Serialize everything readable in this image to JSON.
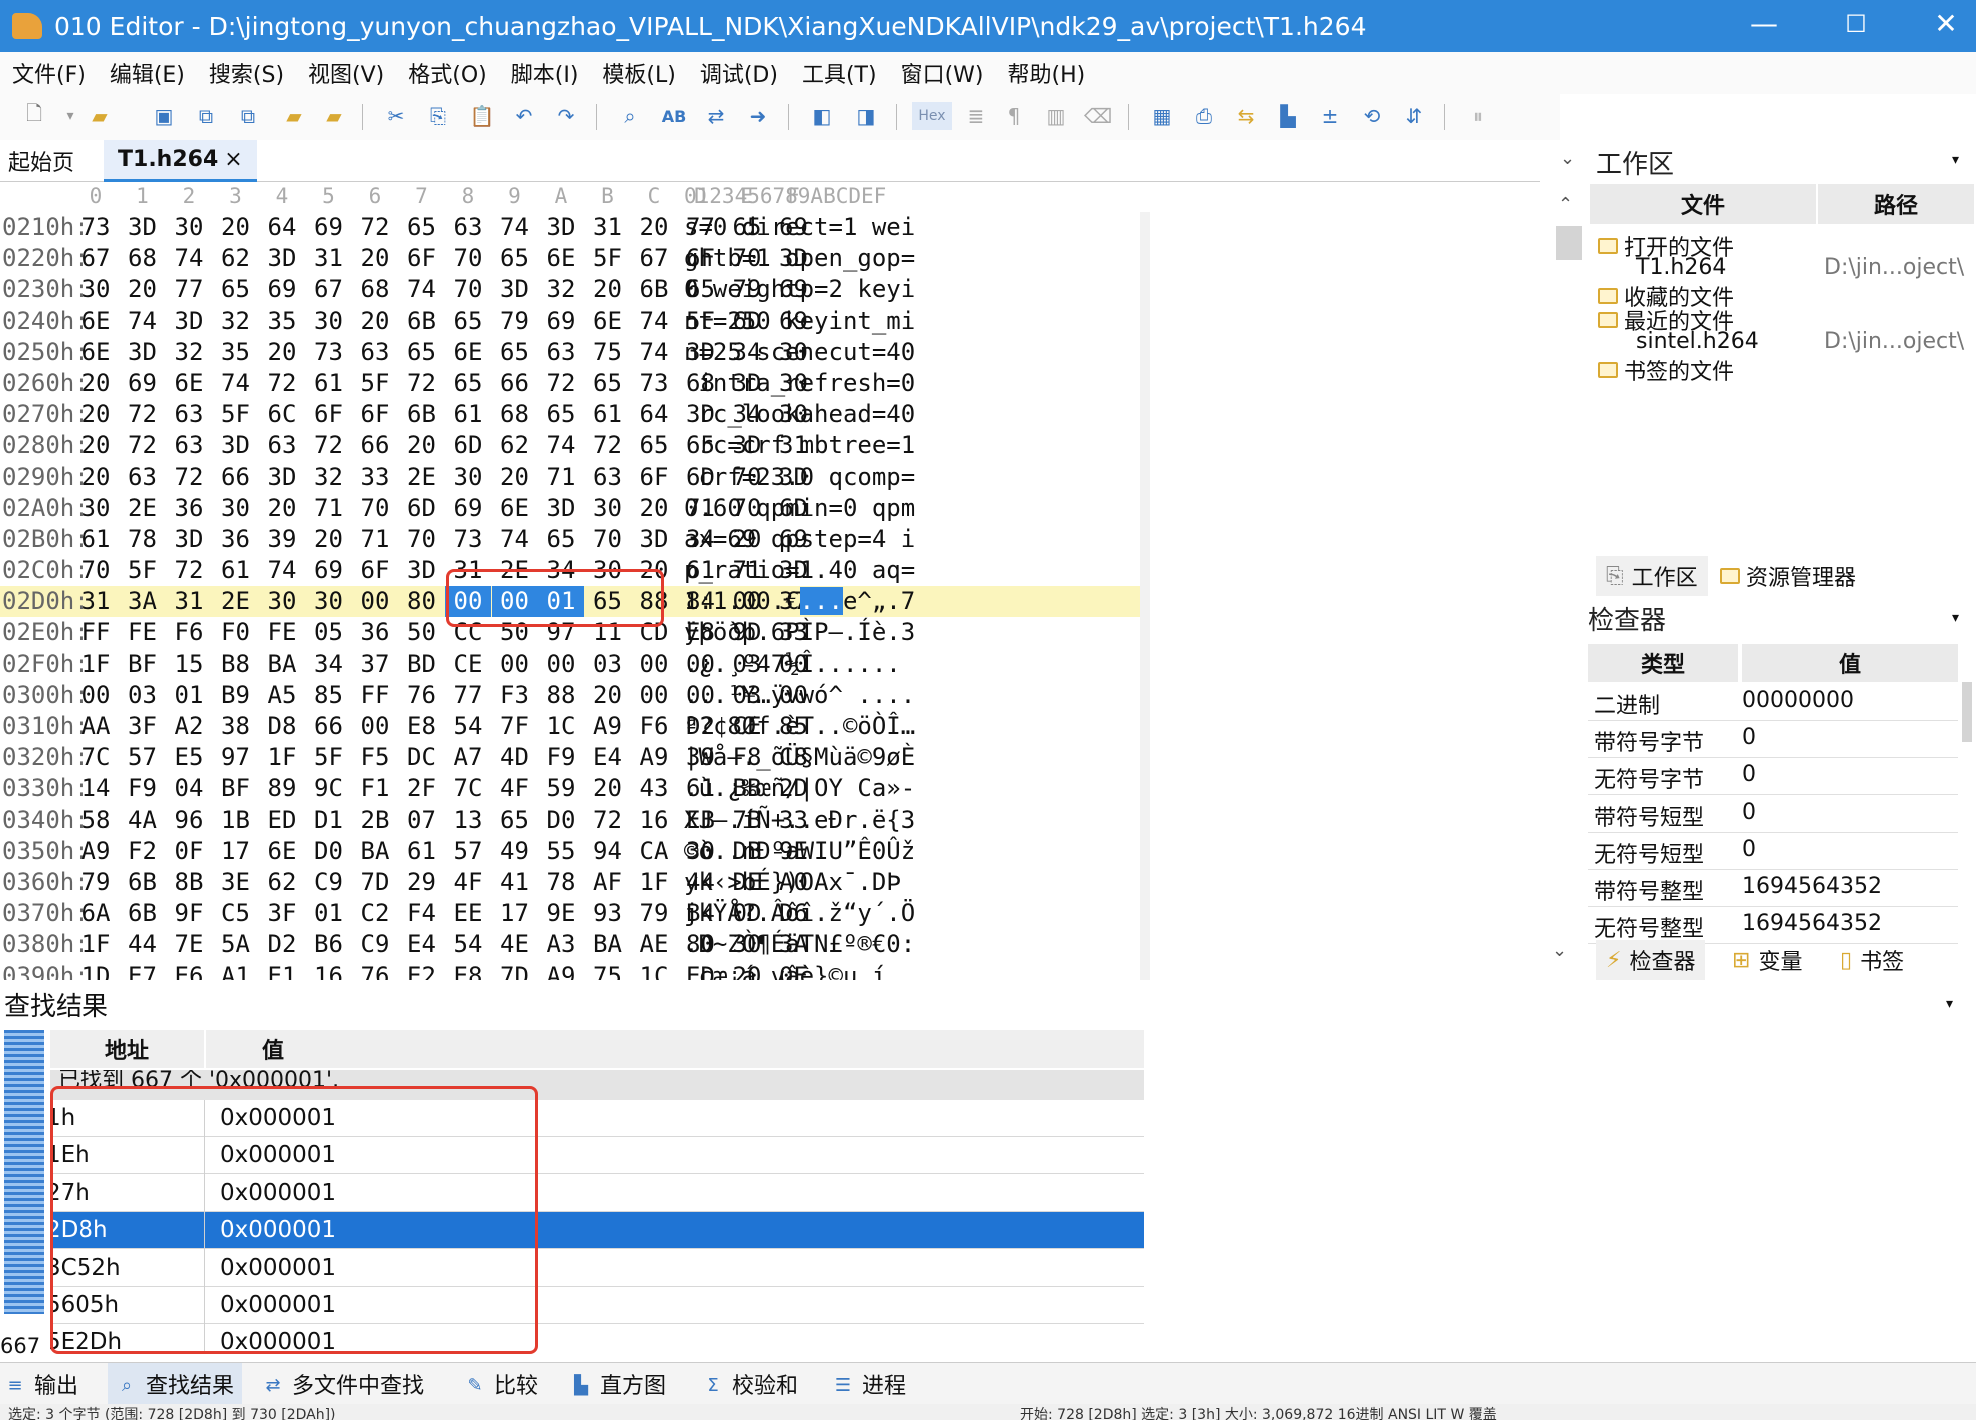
{
  "window": {
    "title": "010 Editor - D:\\jingtong_yunyon_chuangzhao_VIPALL_NDK\\XiangXueNDKAllVIP\\ndk29_av\\project\\T1.h264",
    "minimize": "—",
    "maximize": "☐",
    "close": "✕"
  },
  "menu": [
    "文件(F)",
    "编辑(E)",
    "搜索(S)",
    "视图(V)",
    "格式(O)",
    "脚本(I)",
    "模板(L)",
    "调试(D)",
    "工具(T)",
    "窗口(W)",
    "帮助(H)"
  ],
  "tabs": {
    "start": "起始页",
    "file": "T1.h264",
    "close": "×"
  },
  "toolbar": {
    "hex_label": "Hex"
  },
  "hex": {
    "col_headers": [
      "0",
      "1",
      "2",
      "3",
      "4",
      "5",
      "6",
      "7",
      "8",
      "9",
      "A",
      "B",
      "C",
      "D",
      "E",
      "F"
    ],
    "ascii_header": "0123456789ABCDEF",
    "rows": [
      {
        "addr": "0210h:",
        "bytes": [
          "73",
          "3D",
          "30",
          "20",
          "64",
          "69",
          "72",
          "65",
          "63",
          "74",
          "3D",
          "31",
          "20",
          "77",
          "65",
          "69"
        ],
        "ascii": "s=0 direct=1 wei"
      },
      {
        "addr": "0220h:",
        "bytes": [
          "67",
          "68",
          "74",
          "62",
          "3D",
          "31",
          "20",
          "6F",
          "70",
          "65",
          "6E",
          "5F",
          "67",
          "6F",
          "70",
          "3D"
        ],
        "ascii": "ghtb=1 open_gop="
      },
      {
        "addr": "0230h:",
        "bytes": [
          "30",
          "20",
          "77",
          "65",
          "69",
          "67",
          "68",
          "74",
          "70",
          "3D",
          "32",
          "20",
          "6B",
          "65",
          "79",
          "69"
        ],
        "ascii": "0 weightp=2 keyi"
      },
      {
        "addr": "0240h:",
        "bytes": [
          "6E",
          "74",
          "3D",
          "32",
          "35",
          "30",
          "20",
          "6B",
          "65",
          "79",
          "69",
          "6E",
          "74",
          "5F",
          "6D",
          "69"
        ],
        "ascii": "nt=250 keyint_mi"
      },
      {
        "addr": "0250h:",
        "bytes": [
          "6E",
          "3D",
          "32",
          "35",
          "20",
          "73",
          "63",
          "65",
          "6E",
          "65",
          "63",
          "75",
          "74",
          "3D",
          "34",
          "30"
        ],
        "ascii": "n=25 scenecut=40"
      },
      {
        "addr": "0260h:",
        "bytes": [
          "20",
          "69",
          "6E",
          "74",
          "72",
          "61",
          "5F",
          "72",
          "65",
          "66",
          "72",
          "65",
          "73",
          "68",
          "3D",
          "30"
        ],
        "ascii": " intra_refresh=0"
      },
      {
        "addr": "0270h:",
        "bytes": [
          "20",
          "72",
          "63",
          "5F",
          "6C",
          "6F",
          "6F",
          "6B",
          "61",
          "68",
          "65",
          "61",
          "64",
          "3D",
          "34",
          "30"
        ],
        "ascii": " rc_lookahead=40"
      },
      {
        "addr": "0280h:",
        "bytes": [
          "20",
          "72",
          "63",
          "3D",
          "63",
          "72",
          "66",
          "20",
          "6D",
          "62",
          "74",
          "72",
          "65",
          "65",
          "3D",
          "31"
        ],
        "ascii": " rc=crf mbtree=1"
      },
      {
        "addr": "0290h:",
        "bytes": [
          "20",
          "63",
          "72",
          "66",
          "3D",
          "32",
          "33",
          "2E",
          "30",
          "20",
          "71",
          "63",
          "6F",
          "6D",
          "70",
          "3D"
        ],
        "ascii": " crf=23.0 qcomp="
      },
      {
        "addr": "02A0h:",
        "bytes": [
          "30",
          "2E",
          "36",
          "30",
          "20",
          "71",
          "70",
          "6D",
          "69",
          "6E",
          "3D",
          "30",
          "20",
          "71",
          "70",
          "6D"
        ],
        "ascii": "0.60 qpmin=0 qpm"
      },
      {
        "addr": "02B0h:",
        "bytes": [
          "61",
          "78",
          "3D",
          "36",
          "39",
          "20",
          "71",
          "70",
          "73",
          "74",
          "65",
          "70",
          "3D",
          "34",
          "20",
          "69"
        ],
        "ascii": "ax=69 qpstep=4 i"
      },
      {
        "addr": "02C0h:",
        "bytes": [
          "70",
          "5F",
          "72",
          "61",
          "74",
          "69",
          "6F",
          "3D",
          "31",
          "2E",
          "34",
          "30",
          "20",
          "61",
          "71",
          "3D"
        ],
        "ascii": "p_ratio=1.40 aq="
      },
      {
        "addr": "02D0h:",
        "bytes": [
          "31",
          "3A",
          "31",
          "2E",
          "30",
          "30",
          "00",
          "80",
          "00",
          "00",
          "01",
          "65",
          "88",
          "84",
          "00",
          "37"
        ],
        "ascii_pre": "1:1.00.€",
        "ascii_sel": "...",
        "ascii_post": "e^„.7",
        "highlight": true
      },
      {
        "addr": "02E0h:",
        "bytes": [
          "FF",
          "FE",
          "F6",
          "F0",
          "FE",
          "05",
          "36",
          "50",
          "CC",
          "50",
          "97",
          "11",
          "CD",
          "E8",
          "9D",
          "33"
        ],
        "ascii": "ÿþöðþ.6PÌP—.Íè.3"
      },
      {
        "addr": "02F0h:",
        "bytes": [
          "1F",
          "BF",
          "15",
          "B8",
          "BA",
          "34",
          "37",
          "BD",
          "CE",
          "00",
          "00",
          "03",
          "00",
          "00",
          "03",
          "00"
        ],
        "ascii": ".¿.¸º47½Î......"
      },
      {
        "addr": "0300h:",
        "bytes": [
          "00",
          "03",
          "01",
          "B9",
          "A5",
          "85",
          "FF",
          "76",
          "77",
          "F3",
          "88",
          "20",
          "00",
          "00",
          "03",
          "00"
        ],
        "ascii": "...¹¥…ÿvwó^ ...."
      },
      {
        "addr": "0310h:",
        "bytes": [
          "AA",
          "3F",
          "A2",
          "38",
          "D8",
          "66",
          "00",
          "E8",
          "54",
          "7F",
          "1C",
          "A9",
          "F6",
          "D2",
          "CE",
          "85"
        ],
        "ascii": "ª?¢8Øf.èT..©öÒÎ…"
      },
      {
        "addr": "0320h:",
        "bytes": [
          "7C",
          "57",
          "E5",
          "97",
          "1F",
          "5F",
          "F5",
          "DC",
          "A7",
          "4D",
          "F9",
          "E4",
          "A9",
          "39",
          "F8",
          "C8"
        ],
        "ascii": "|Wå—._õÜ§Mùä©9øÈ"
      },
      {
        "addr": "0330h:",
        "bytes": [
          "14",
          "F9",
          "04",
          "BF",
          "89",
          "9C",
          "F1",
          "2F",
          "7C",
          "4F",
          "59",
          "20",
          "43",
          "61",
          "BB",
          "2D"
        ],
        "ascii": ".ù.¿‰œñ/|OY Ca»-"
      },
      {
        "addr": "0340h:",
        "bytes": [
          "58",
          "4A",
          "96",
          "1B",
          "ED",
          "D1",
          "2B",
          "07",
          "13",
          "65",
          "D0",
          "72",
          "16",
          "EB",
          "7B",
          "33"
        ],
        "ascii": "XJ–.íÑ+..eÐr.ë{3"
      },
      {
        "addr": "0350h:",
        "bytes": [
          "A9",
          "F2",
          "0F",
          "17",
          "6E",
          "D0",
          "BA",
          "61",
          "57",
          "49",
          "55",
          "94",
          "CA",
          "30",
          "DB",
          "9E"
        ],
        "ascii": "©ò..nÐºaWIU”Ê0Ûž"
      },
      {
        "addr": "0360h:",
        "bytes": [
          "79",
          "6B",
          "8B",
          "3E",
          "62",
          "C9",
          "7D",
          "29",
          "4F",
          "41",
          "78",
          "AF",
          "1F",
          "44",
          "DE",
          "A0"
        ],
        "ascii": "yk‹>bÉ})OAx¯.DÞ "
      },
      {
        "addr": "0370h:",
        "bytes": [
          "6A",
          "6B",
          "9F",
          "C5",
          "3F",
          "01",
          "C2",
          "F4",
          "EE",
          "17",
          "9E",
          "93",
          "79",
          "B4",
          "0D",
          "D6"
        ],
        "ascii": "jkŸÅ?.Âôî.ž“y´.Ö"
      },
      {
        "addr": "0380h:",
        "bytes": [
          "1F",
          "44",
          "7E",
          "5A",
          "D2",
          "B6",
          "C9",
          "E4",
          "54",
          "4E",
          "A3",
          "BA",
          "AE",
          "80",
          "30",
          "3A"
        ],
        "ascii": ".D~ZÒ¶ÉäTN£º®€0:"
      },
      {
        "addr": "0390h:",
        "bytes": [
          "1D",
          "E7",
          "E6",
          "A1",
          "E1",
          "16",
          "76",
          "E2",
          "E8",
          "7D",
          "A9",
          "75",
          "1C",
          "ED",
          "20",
          "0E"
        ],
        "ascii": ".çæ¡á.vâè}©u.í ."
      }
    ]
  },
  "workspace": {
    "title": "工作区",
    "col_file": "文件",
    "col_path": "路径",
    "items": [
      {
        "label": "打开的文件",
        "path": "",
        "folder": true
      },
      {
        "label": "T1.h264",
        "path": "D:\\jin...oject\\",
        "folder": false
      },
      {
        "label": "收藏的文件",
        "path": "",
        "folder": true
      },
      {
        "label": "最近的文件",
        "path": "",
        "folder": true
      },
      {
        "label": "sintel.h264",
        "path": "D:\\jin...oject\\",
        "folder": false
      },
      {
        "label": "书签的文件",
        "path": "",
        "folder": true
      }
    ],
    "tab_workspace": "工作区",
    "tab_explorer": "资源管理器"
  },
  "inspector": {
    "title": "检查器",
    "col_type": "类型",
    "col_value": "值",
    "rows": [
      {
        "type": "二进制",
        "value": "00000000"
      },
      {
        "type": "带符号字节",
        "value": "0"
      },
      {
        "type": "无符号字节",
        "value": "0"
      },
      {
        "type": "带符号短型",
        "value": "0"
      },
      {
        "type": "无符号短型",
        "value": "0"
      },
      {
        "type": "带符号整型",
        "value": "1694564352"
      },
      {
        "type": "无符号整型",
        "value": "1694564352"
      }
    ],
    "tab_inspector": "检查器",
    "tab_variables": "变量",
    "tab_bookmarks": "书签"
  },
  "find": {
    "title": "查找结果",
    "col_address": "地址",
    "col_value": "值",
    "summary": "已找到 667 个 '0x000001'.",
    "count_label": "667",
    "rows": [
      {
        "addr": "1h",
        "value": "0x000001"
      },
      {
        "addr": "1Eh",
        "value": "0x000001"
      },
      {
        "addr": "27h",
        "value": "0x000001"
      },
      {
        "addr": "2D8h",
        "value": "0x000001",
        "selected": true
      },
      {
        "addr": "3C52h",
        "value": "0x000001"
      },
      {
        "addr": "5605h",
        "value": "0x000001"
      },
      {
        "addr": "5E2Dh",
        "value": "0x000001"
      }
    ]
  },
  "bottom_tabs": [
    "输出",
    "查找结果",
    "多文件中查找",
    "比较",
    "直方图",
    "校验和",
    "进程"
  ],
  "status": {
    "left": "选定: 3 个字节 (范围: 728 [2D8h] 到 730 [2DAh])",
    "right": "开始: 728 [2D8h] 选定: 3 [3h] 大小: 3,069,872 16进制 ANSI LIT W 覆盖"
  },
  "colors": {
    "accent": "#2f87d9",
    "selection": "#2f86e0",
    "highlight_row": "#fbf5bd",
    "annotation": "#e23b2e"
  }
}
